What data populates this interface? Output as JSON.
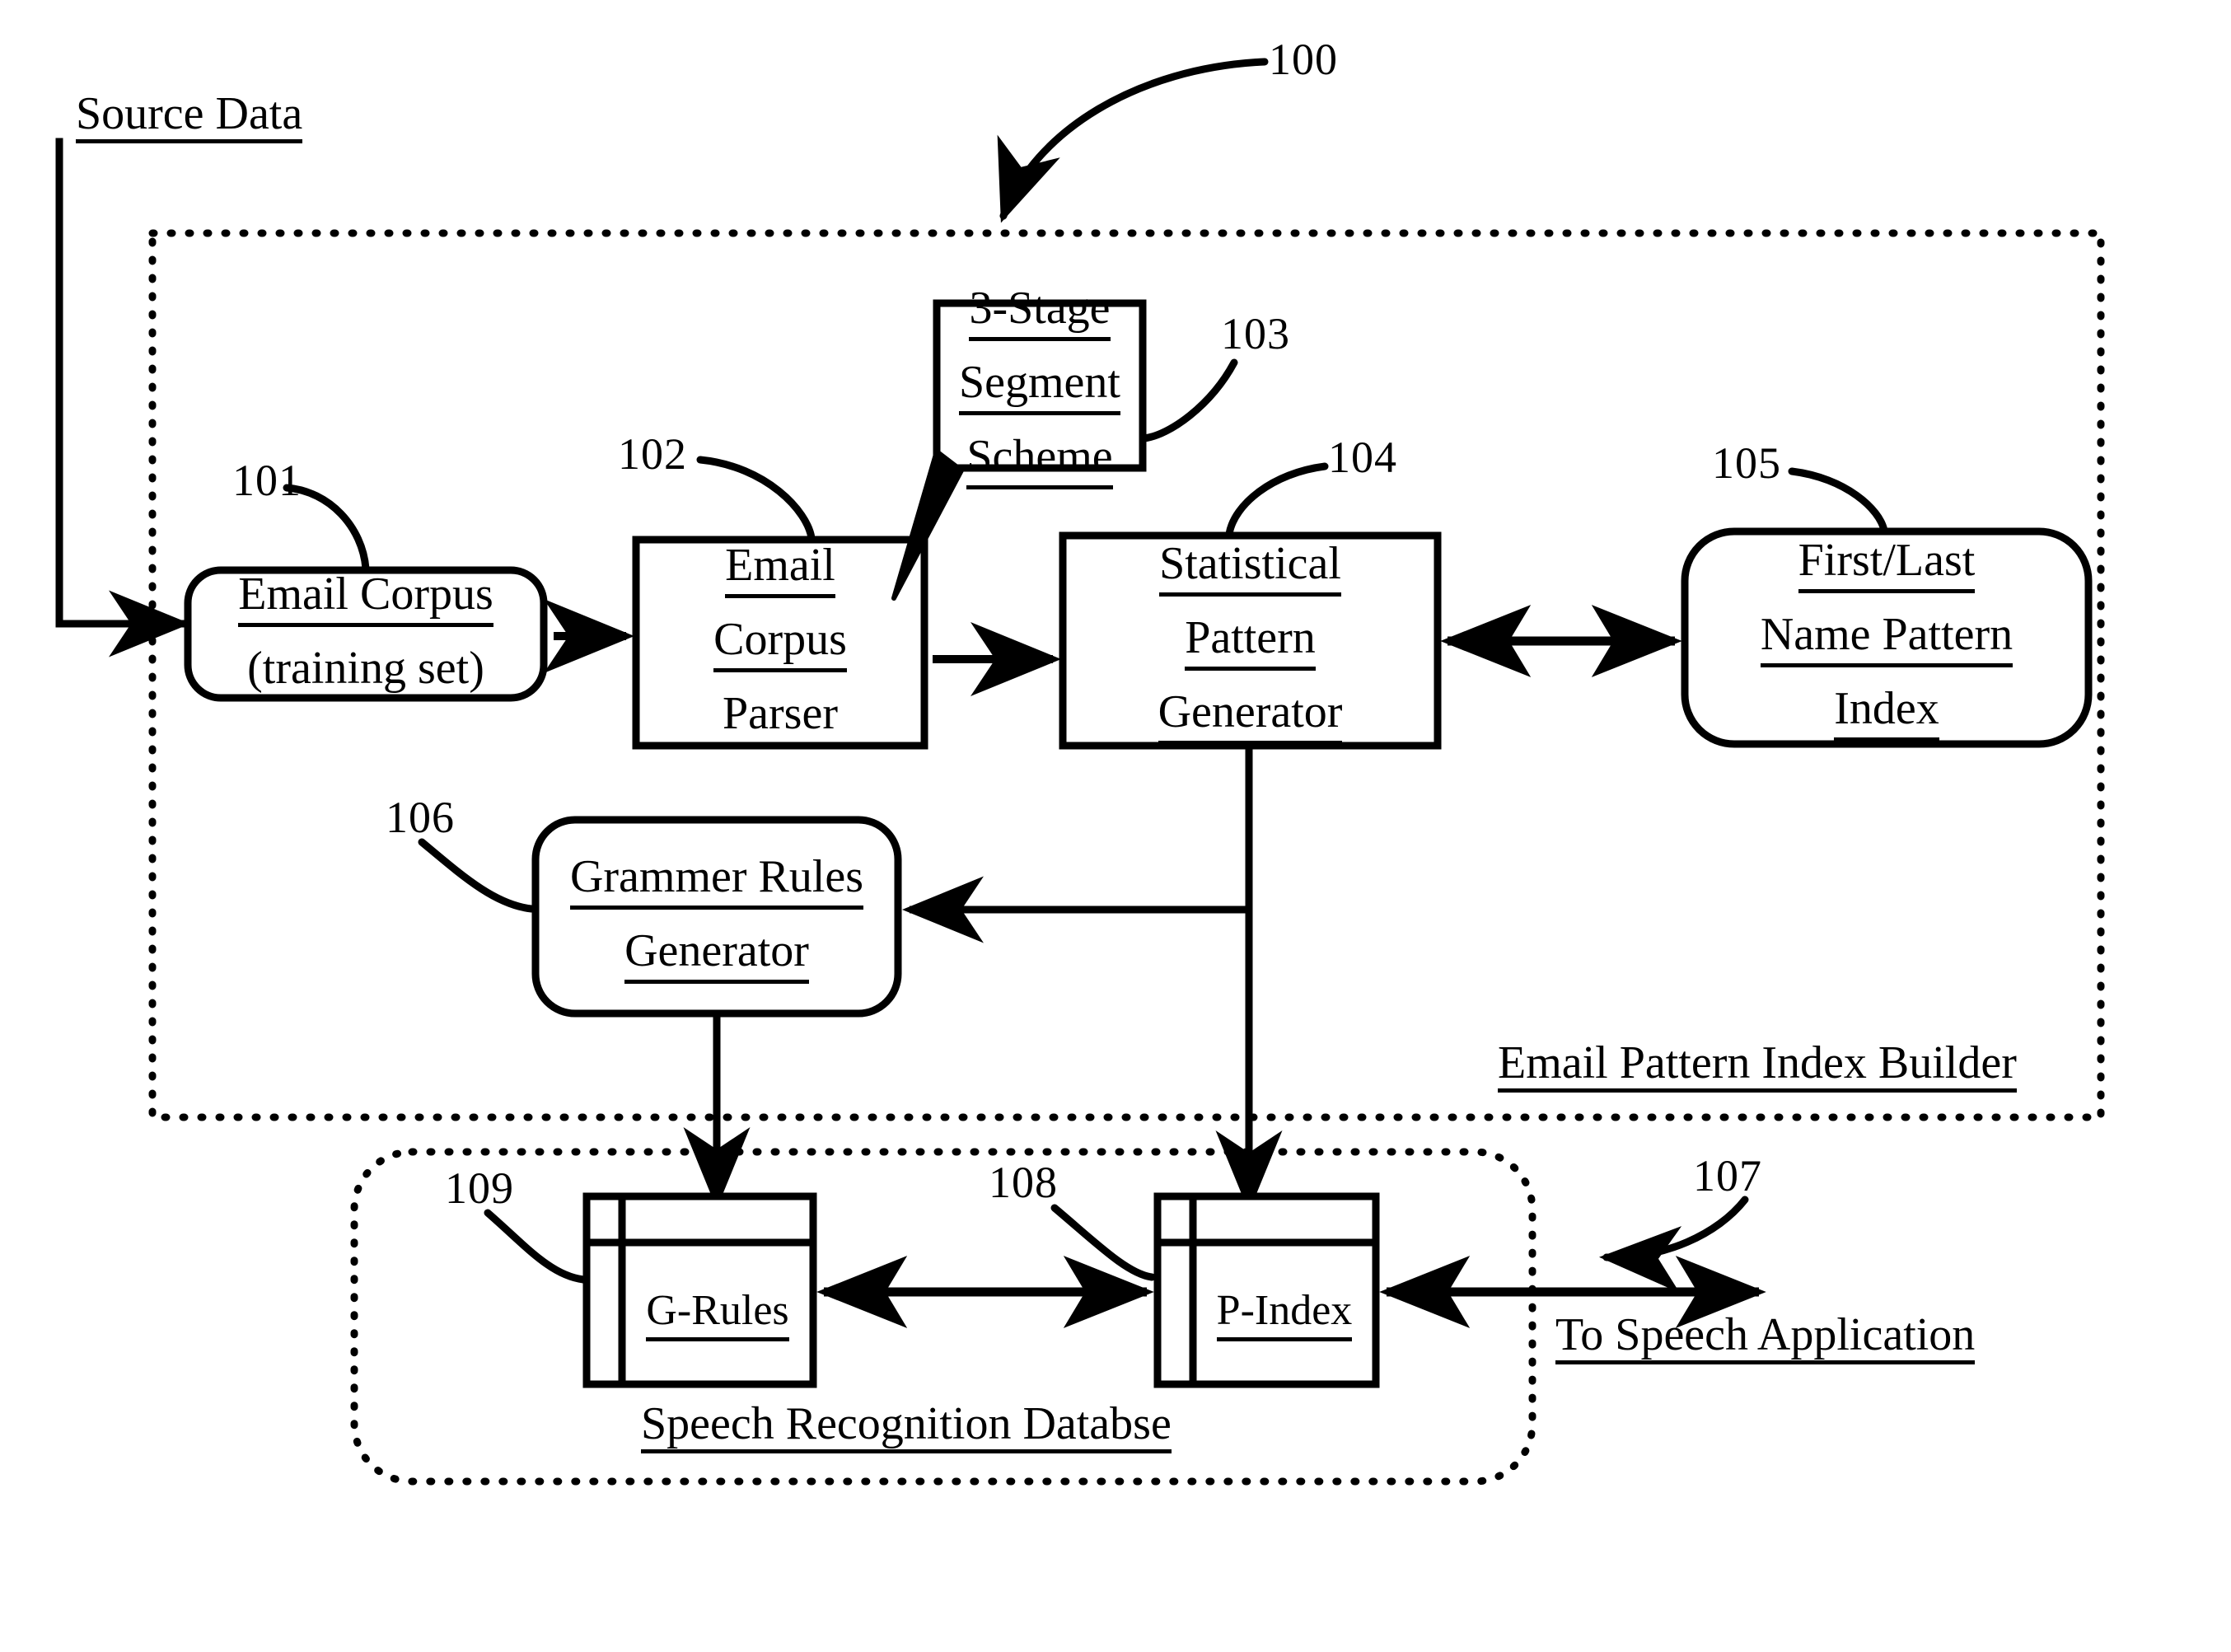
{
  "figure": {
    "title": "Email Pattern Index Builder block diagram",
    "ink_color": "#000000",
    "background": "#ffffff"
  },
  "reference_numerals": {
    "system": "100",
    "email_corpus": "101",
    "email_corpus_parser": "102",
    "segment_scheme": "103",
    "statistical_pattern_generator": "104",
    "name_pattern_index": "105",
    "grammer_rules_generator": "106",
    "to_speech_application": "107",
    "p_index": "108",
    "g_rules": "109"
  },
  "labels": {
    "source_data": "Source Data",
    "email_pattern_index_builder": "Email Pattern Index Builder",
    "speech_recognition_database": "Speech Recognition Databse",
    "to_speech_application": "To Speech Application"
  },
  "boxes": {
    "email_corpus": {
      "shape": "rounded-rectangle",
      "lines": [
        "Email Corpus",
        "(training set)"
      ]
    },
    "email_corpus_parser": {
      "shape": "rectangle",
      "lines": [
        "Email",
        "Corpus",
        "Parser"
      ]
    },
    "segment_scheme": {
      "shape": "callout",
      "lines": [
        "3-Stage",
        "Segment",
        "Scheme"
      ]
    },
    "statistical_pattern_generator": {
      "shape": "rectangle",
      "lines": [
        "Statistical",
        "Pattern",
        "Generator"
      ]
    },
    "name_pattern_index": {
      "shape": "rounded-rectangle",
      "lines": [
        "First/Last",
        "Name Pattern",
        "Index"
      ]
    },
    "grammer_rules_generator": {
      "shape": "rounded-rectangle",
      "lines": [
        "Grammer Rules",
        "Generator"
      ]
    },
    "g_rules": {
      "shape": "database",
      "lines": [
        "G-Rules"
      ]
    },
    "p_index": {
      "shape": "database",
      "lines": [
        "P-Index"
      ]
    }
  },
  "containers": {
    "builder": {
      "border": "dotted",
      "label": "Email Pattern Index Builder"
    },
    "speech_db": {
      "border": "dotted",
      "label": "Speech Recognition Databse"
    }
  }
}
